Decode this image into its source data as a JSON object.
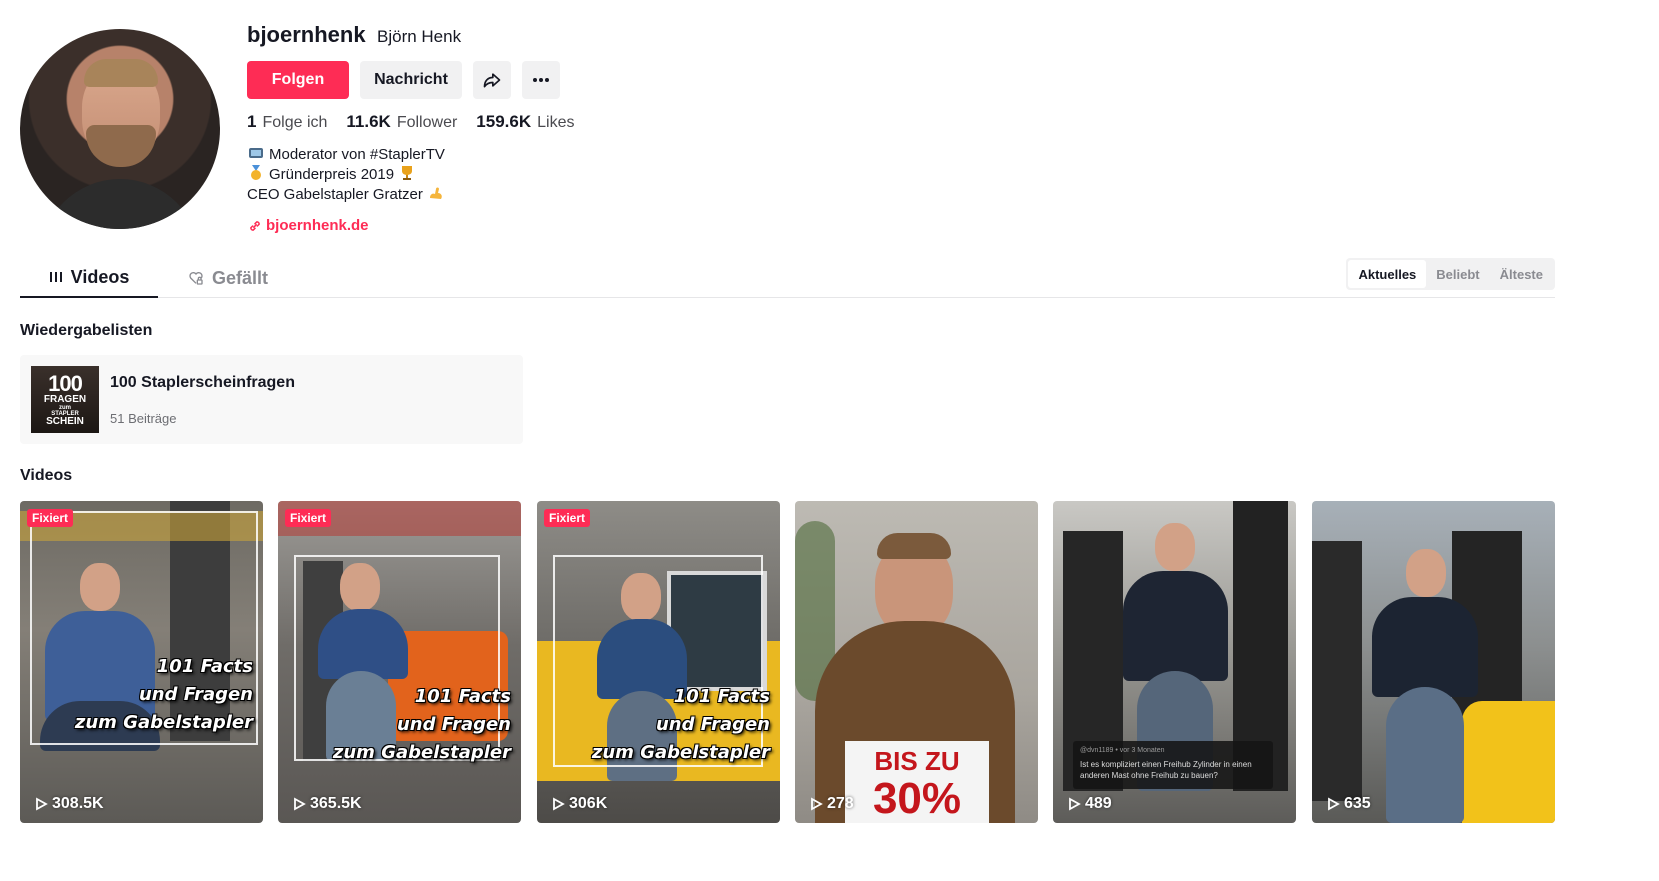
{
  "profile": {
    "username": "bjoernhenk",
    "nickname": "Björn Henk",
    "follow_label": "Folgen",
    "message_label": "Nachricht",
    "stats": [
      {
        "value": "1",
        "label": "Folge ich"
      },
      {
        "value": "11.6K",
        "label": "Follower"
      },
      {
        "value": "159.6K",
        "label": "Likes"
      }
    ],
    "bio": [
      {
        "icon": "tv-icon",
        "text": "Moderator von #StaplerTV"
      },
      {
        "icon": "medal-icon",
        "text": " Gründerpreis 2019",
        "trail_icon": "trophy-icon"
      },
      {
        "text": "CEO Gabelstapler Gratzer",
        "trail_icon": "muscle-icon"
      }
    ],
    "link": "bjoernhenk.de"
  },
  "tabs": [
    {
      "label": "Videos",
      "icon": "grid-icon",
      "active": true
    },
    {
      "label": "Gefällt",
      "icon": "heart-lock-icon",
      "active": false
    }
  ],
  "sort": {
    "options": [
      "Aktuelles",
      "Beliebt",
      "Älteste"
    ],
    "selected": "Aktuelles"
  },
  "playlists": {
    "title": "Wiedergabelisten",
    "items": [
      {
        "title": "100 Staplerscheinfragen",
        "count": "51 Beiträge",
        "thumb_text": [
          "100",
          "FRAGEN",
          "zum",
          "STAPLER",
          "SCHEIN"
        ]
      }
    ]
  },
  "videos": {
    "title": "Videos",
    "items": [
      {
        "views": "308.5K",
        "pinned": "Fixiert",
        "caption": [
          "101 Facts",
          "und Fragen",
          "zum Gabelstapler"
        ]
      },
      {
        "views": "365.5K",
        "pinned": "Fixiert",
        "caption": [
          "101 Facts",
          "und Fragen",
          "zum Gabelstapler"
        ]
      },
      {
        "views": "306K",
        "pinned": "Fixiert",
        "caption": [
          "101 Facts",
          "und Fragen",
          "zum Gabelstapler"
        ]
      },
      {
        "views": "278",
        "promo": [
          "BIS ZU",
          "30%"
        ]
      },
      {
        "views": "489",
        "comment": {
          "user": "@dvn1189 • vor 3 Monaten",
          "text": "Ist es kompliziert einen Freihub Zylinder in einen anderen Mast ohne Freihub zu bauen?"
        }
      },
      {
        "views": "635"
      }
    ]
  },
  "colors": {
    "accent": "#fe2c55",
    "text": "#161823",
    "muted": "#8a8b91",
    "button_bg": "#f1f1f2"
  }
}
